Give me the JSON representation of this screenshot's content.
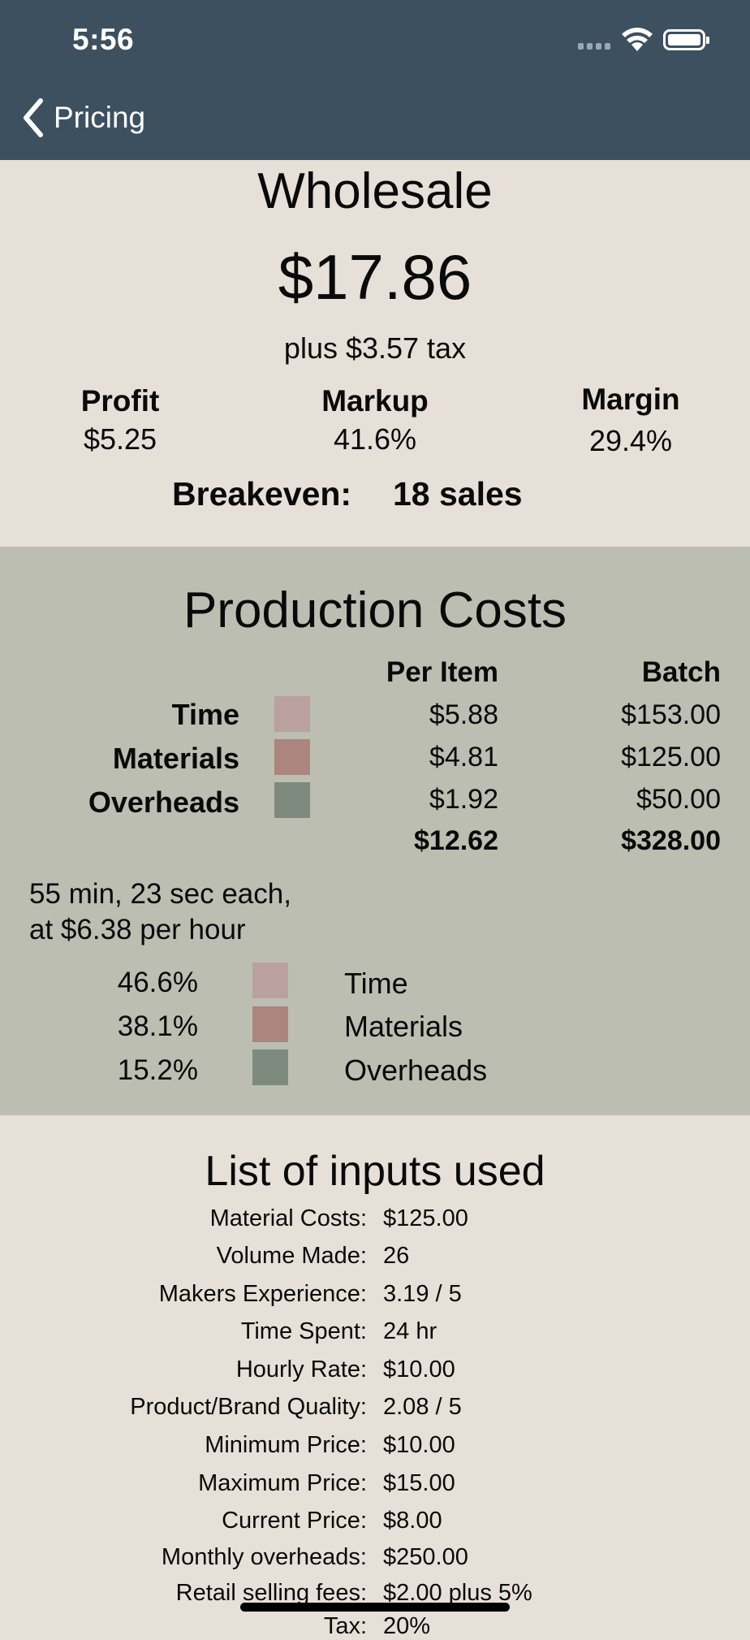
{
  "status_bar": {
    "time": "5:56"
  },
  "nav": {
    "back_label": "Pricing"
  },
  "wholesale": {
    "title": "Wholesale",
    "price": "$17.86",
    "tax_note": "plus $3.57 tax",
    "stats": [
      {
        "label": "Profit",
        "value": "$5.25"
      },
      {
        "label": "Markup",
        "value": "41.6%"
      },
      {
        "label": "Margin",
        "value": "29.4%"
      }
    ],
    "breakeven_label": "Breakeven:",
    "breakeven_value": "18 sales"
  },
  "production": {
    "title": "Production Costs",
    "col_per_item": "Per Item",
    "col_batch": "Batch",
    "rows": [
      {
        "label": "Time",
        "color": "#bba0a0",
        "per_item": "$5.88",
        "batch": "$153.00"
      },
      {
        "label": "Materials",
        "color": "#ab857e",
        "per_item": "$4.81",
        "batch": "$125.00"
      },
      {
        "label": "Overheads",
        "color": "#7e8a7e",
        "per_item": "$1.92",
        "batch": "$50.00"
      }
    ],
    "total_per_item": "$12.62",
    "total_batch": "$328.00",
    "time_note_1": "55 min, 23 sec each,",
    "time_note_2": "at $6.38 per hour",
    "breakdown": [
      {
        "percent": "46.6%",
        "label": "Time",
        "color": "#bba0a0"
      },
      {
        "percent": "38.1%",
        "label": "Materials",
        "color": "#ab857e"
      },
      {
        "percent": "15.2%",
        "label": "Overheads",
        "color": "#7e8a7e"
      }
    ]
  },
  "inputs": {
    "title": "List of inputs used",
    "items": [
      {
        "label": "Material Costs:",
        "value": "$125.00"
      },
      {
        "label": "Volume Made:",
        "value": "26"
      },
      {
        "label": "Makers Experience:",
        "value": "3.19 / 5"
      },
      {
        "label": "Time Spent:",
        "value": "24 hr"
      },
      {
        "label": "Hourly Rate:",
        "value": "$10.00"
      },
      {
        "label": "Product/Brand Quality:",
        "value": "2.08 / 5"
      },
      {
        "label": "Minimum Price:",
        "value": "$10.00"
      },
      {
        "label": "Maximum Price:",
        "value": "$15.00"
      },
      {
        "label": "Current Price:",
        "value": "$8.00"
      },
      {
        "label": "Monthly overheads:",
        "value": "$250.00"
      },
      {
        "label": "Retail selling fees:",
        "value": "$2.00 plus 5%"
      },
      {
        "label": "Tax:",
        "value": "20%"
      }
    ]
  }
}
